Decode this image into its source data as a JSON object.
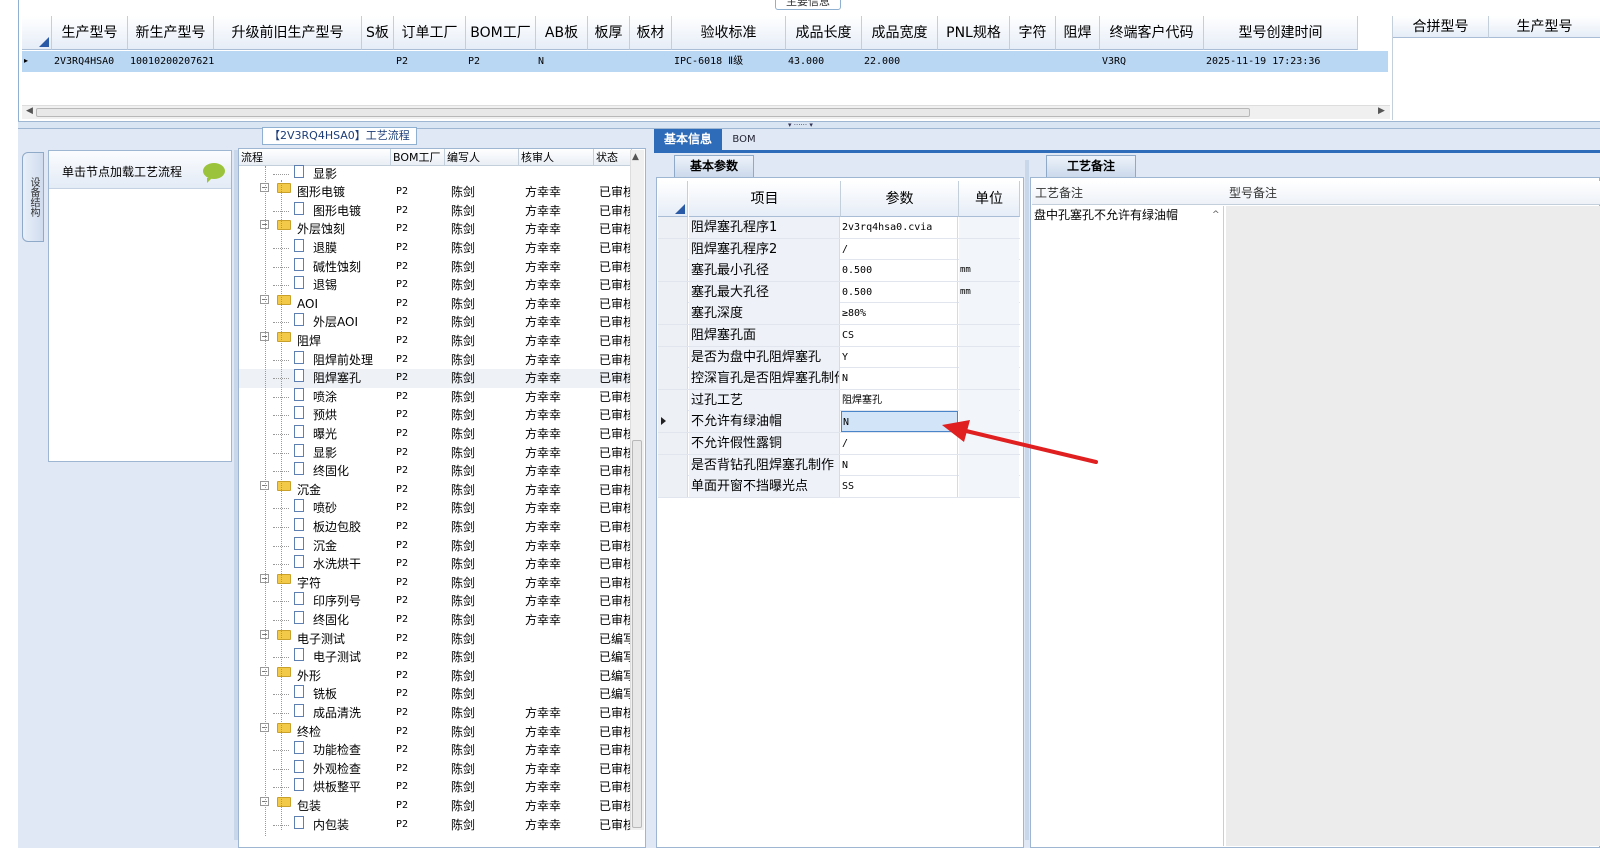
{
  "top": {
    "section_tab": "主要信息",
    "columns": [
      "生产型号",
      "新生产型号",
      "升级前旧生产型号",
      "S板",
      "订单工厂",
      "BOM工厂",
      "AB板",
      "板厚",
      "板材",
      "验收标准",
      "成品长度",
      "成品宽度",
      "PNL规格",
      "字符",
      "阻焊",
      "终端客户代码",
      "型号创建时间"
    ],
    "row": [
      "2V3RQ4HSA0",
      "10010200207621",
      "",
      "",
      "P2",
      "P2",
      "N",
      "",
      "",
      "IPC-6018 Ⅱ级",
      "43.000",
      "22.000",
      "",
      "",
      "",
      "V3RQ",
      "2025-11-19 17:23:36"
    ],
    "right_columns": [
      "合拼型号",
      "生产型号"
    ]
  },
  "left": {
    "vtab_label": "设备结构",
    "load_label": "单击节点加载工艺流程",
    "flow_title": "【2V3RQ4HSA0】工艺流程",
    "flow_columns": [
      "流程",
      "BOM工厂",
      "编写人",
      "核审人",
      "状态"
    ],
    "flow_rows": [
      {
        "name": "显影",
        "lvl": 2,
        "factory": "",
        "writer": "",
        "checker": "",
        "status": "",
        "partial": true
      },
      {
        "name": "图形电镀",
        "lvl": 1,
        "factory": "P2",
        "writer": "陈剑",
        "checker": "方幸幸",
        "status": "已审核"
      },
      {
        "name": "图形电镀",
        "lvl": 2,
        "factory": "P2",
        "writer": "陈剑",
        "checker": "方幸幸",
        "status": "已审核"
      },
      {
        "name": "外层蚀刻",
        "lvl": 1,
        "factory": "P2",
        "writer": "陈剑",
        "checker": "方幸幸",
        "status": "已审核"
      },
      {
        "name": "退膜",
        "lvl": 2,
        "factory": "P2",
        "writer": "陈剑",
        "checker": "方幸幸",
        "status": "已审核"
      },
      {
        "name": "碱性蚀刻",
        "lvl": 2,
        "factory": "P2",
        "writer": "陈剑",
        "checker": "方幸幸",
        "status": "已审核"
      },
      {
        "name": "退锡",
        "lvl": 2,
        "factory": "P2",
        "writer": "陈剑",
        "checker": "方幸幸",
        "status": "已审核"
      },
      {
        "name": "AOI",
        "lvl": 1,
        "factory": "P2",
        "writer": "陈剑",
        "checker": "方幸幸",
        "status": "已审核"
      },
      {
        "name": "外层AOI",
        "lvl": 2,
        "factory": "P2",
        "writer": "陈剑",
        "checker": "方幸幸",
        "status": "已审核"
      },
      {
        "name": "阻焊",
        "lvl": 1,
        "factory": "P2",
        "writer": "陈剑",
        "checker": "方幸幸",
        "status": "已审核"
      },
      {
        "name": "阻焊前处理",
        "lvl": 2,
        "factory": "P2",
        "writer": "陈剑",
        "checker": "方幸幸",
        "status": "已审核"
      },
      {
        "name": "阻焊塞孔",
        "lvl": 2,
        "factory": "P2",
        "writer": "陈剑",
        "checker": "方幸幸",
        "status": "已审核",
        "selected": true
      },
      {
        "name": "喷涂",
        "lvl": 2,
        "factory": "P2",
        "writer": "陈剑",
        "checker": "方幸幸",
        "status": "已审核"
      },
      {
        "name": "预烘",
        "lvl": 2,
        "factory": "P2",
        "writer": "陈剑",
        "checker": "方幸幸",
        "status": "已审核"
      },
      {
        "name": "曝光",
        "lvl": 2,
        "factory": "P2",
        "writer": "陈剑",
        "checker": "方幸幸",
        "status": "已审核"
      },
      {
        "name": "显影",
        "lvl": 2,
        "factory": "P2",
        "writer": "陈剑",
        "checker": "方幸幸",
        "status": "已审核"
      },
      {
        "name": "终固化",
        "lvl": 2,
        "factory": "P2",
        "writer": "陈剑",
        "checker": "方幸幸",
        "status": "已审核"
      },
      {
        "name": "沉金",
        "lvl": 1,
        "factory": "P2",
        "writer": "陈剑",
        "checker": "方幸幸",
        "status": "已审核"
      },
      {
        "name": "喷砂",
        "lvl": 2,
        "factory": "P2",
        "writer": "陈剑",
        "checker": "方幸幸",
        "status": "已审核"
      },
      {
        "name": "板边包胶",
        "lvl": 2,
        "factory": "P2",
        "writer": "陈剑",
        "checker": "方幸幸",
        "status": "已审核"
      },
      {
        "name": "沉金",
        "lvl": 2,
        "factory": "P2",
        "writer": "陈剑",
        "checker": "方幸幸",
        "status": "已审核"
      },
      {
        "name": "水洗烘干",
        "lvl": 2,
        "factory": "P2",
        "writer": "陈剑",
        "checker": "方幸幸",
        "status": "已审核"
      },
      {
        "name": "字符",
        "lvl": 1,
        "factory": "P2",
        "writer": "陈剑",
        "checker": "方幸幸",
        "status": "已审核"
      },
      {
        "name": "印序列号",
        "lvl": 2,
        "factory": "P2",
        "writer": "陈剑",
        "checker": "方幸幸",
        "status": "已审核"
      },
      {
        "name": "终固化",
        "lvl": 2,
        "factory": "P2",
        "writer": "陈剑",
        "checker": "方幸幸",
        "status": "已审核"
      },
      {
        "name": "电子测试",
        "lvl": 1,
        "factory": "P2",
        "writer": "陈剑",
        "checker": "",
        "status": "已编写"
      },
      {
        "name": "电子测试",
        "lvl": 2,
        "factory": "P2",
        "writer": "陈剑",
        "checker": "",
        "status": "已编写"
      },
      {
        "name": "外形",
        "lvl": 1,
        "factory": "P2",
        "writer": "陈剑",
        "checker": "",
        "status": "已编写"
      },
      {
        "name": "铣板",
        "lvl": 2,
        "factory": "P2",
        "writer": "陈剑",
        "checker": "",
        "status": "已编写"
      },
      {
        "name": "成品清洗",
        "lvl": 2,
        "factory": "P2",
        "writer": "陈剑",
        "checker": "方幸幸",
        "status": "已审核"
      },
      {
        "name": "终检",
        "lvl": 1,
        "factory": "P2",
        "writer": "陈剑",
        "checker": "方幸幸",
        "status": "已审核"
      },
      {
        "name": "功能检查",
        "lvl": 2,
        "factory": "P2",
        "writer": "陈剑",
        "checker": "方幸幸",
        "status": "已审核"
      },
      {
        "name": "外观检查",
        "lvl": 2,
        "factory": "P2",
        "writer": "陈剑",
        "checker": "方幸幸",
        "status": "已审核"
      },
      {
        "name": "烘板整平",
        "lvl": 2,
        "factory": "P2",
        "writer": "陈剑",
        "checker": "方幸幸",
        "status": "已审核"
      },
      {
        "name": "包装",
        "lvl": 1,
        "factory": "P2",
        "writer": "陈剑",
        "checker": "方幸幸",
        "status": "已审核"
      },
      {
        "name": "内包装",
        "lvl": 2,
        "factory": "P2",
        "writer": "陈剑",
        "checker": "方幸幸",
        "status": "已审核"
      }
    ]
  },
  "mid": {
    "tab_basic": "基本信息",
    "tab_bom": "BOM",
    "params_tab": "基本参数",
    "columns": [
      "项目",
      "参数",
      "单位"
    ],
    "rows": [
      {
        "item": "阻焊塞孔程序1",
        "value": "2v3rq4hsa0.cvia",
        "unit": ""
      },
      {
        "item": "阻焊塞孔程序2",
        "value": "/",
        "unit": ""
      },
      {
        "item": "塞孔最小孔径",
        "value": "0.500",
        "unit": "mm"
      },
      {
        "item": "塞孔最大孔径",
        "value": "0.500",
        "unit": "mm"
      },
      {
        "item": "塞孔深度",
        "value": "≥80%",
        "unit": ""
      },
      {
        "item": "阻焊塞孔面",
        "value": "CS",
        "unit": ""
      },
      {
        "item": "是否为盘中孔阻焊塞孔",
        "value": "Y",
        "unit": ""
      },
      {
        "item": "控深盲孔是否阻焊塞孔制作",
        "value": "N",
        "unit": ""
      },
      {
        "item": "过孔工艺",
        "value": "阻焊塞孔",
        "unit": ""
      },
      {
        "item": "不允许有绿油帽",
        "value": "N",
        "unit": "",
        "active": true
      },
      {
        "item": "不允许假性露铜",
        "value": "/",
        "unit": ""
      },
      {
        "item": "是否背钻孔阻焊塞孔制作",
        "value": "N",
        "unit": ""
      },
      {
        "item": "单面开窗不挡曝光点",
        "value": "SS",
        "unit": ""
      }
    ]
  },
  "notes": {
    "tab": "工艺备注",
    "proc_header": "工艺备注",
    "model_header": "型号备注",
    "proc_text": "盘中孔塞孔不允许有绿油帽"
  },
  "colors": {
    "accent": "#2e6bb8",
    "selection": "#b9d6f3",
    "annotation_arrow": "#e02020"
  }
}
